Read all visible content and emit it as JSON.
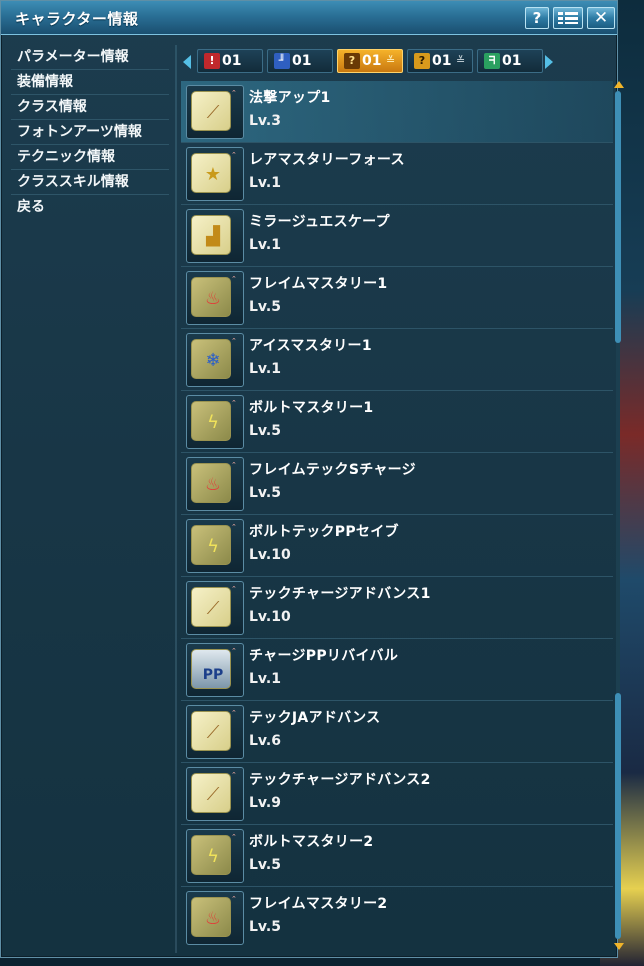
{
  "window": {
    "title": "キャラクター情報",
    "help_label": "?",
    "close_label": "✕"
  },
  "menu": {
    "items": [
      {
        "label": "パラメーター情報"
      },
      {
        "label": "装備情報"
      },
      {
        "label": "クラス情報"
      },
      {
        "label": "フォトンアーツ情報"
      },
      {
        "label": "テクニック情報"
      },
      {
        "label": "クラススキル情報"
      },
      {
        "label": "戻る"
      }
    ]
  },
  "tabs": [
    {
      "label": "01",
      "icon": "fire-icon",
      "color": "#c0282c",
      "active": false
    },
    {
      "label": "01",
      "icon": "ranger-icon",
      "color": "#2f5fc0",
      "active": false
    },
    {
      "label": "01",
      "icon": "force-icon",
      "color": "#e3a020",
      "active": true
    },
    {
      "label": "01",
      "icon": "force-icon",
      "color": "#e3a020",
      "active": false
    },
    {
      "label": "01",
      "icon": "techer-icon",
      "color": "#2aa060",
      "active": false
    }
  ],
  "skills": [
    {
      "name": "法撃アップ1",
      "level": "Lv.3",
      "icon": "staff-icon"
    },
    {
      "name": "レアマスタリーフォース",
      "level": "Lv.1",
      "icon": "staff-star-icon"
    },
    {
      "name": "ミラージュエスケープ",
      "level": "Lv.1",
      "icon": "boot-icon"
    },
    {
      "name": "フレイムマスタリー1",
      "level": "Lv.5",
      "icon": "flame-icon"
    },
    {
      "name": "アイスマスタリー1",
      "level": "Lv.1",
      "icon": "ice-icon"
    },
    {
      "name": "ボルトマスタリー1",
      "level": "Lv.5",
      "icon": "bolt-icon"
    },
    {
      "name": "フレイムテックSチャージ",
      "level": "Lv.5",
      "icon": "flame-icon"
    },
    {
      "name": "ボルトテックPPセイブ",
      "level": "Lv.10",
      "icon": "bolt-icon"
    },
    {
      "name": "テックチャージアドバンス1",
      "level": "Lv.10",
      "icon": "staff-icon"
    },
    {
      "name": "チャージPPリバイバル",
      "level": "Lv.1",
      "icon": "pp-icon"
    },
    {
      "name": "テックJAアドバンス",
      "level": "Lv.6",
      "icon": "staff-icon"
    },
    {
      "name": "テックチャージアドバンス2",
      "level": "Lv.9",
      "icon": "staff-icon"
    },
    {
      "name": "ボルトマスタリー2",
      "level": "Lv.5",
      "icon": "bolt-icon"
    },
    {
      "name": "フレイムマスタリー2",
      "level": "Lv.5",
      "icon": "flame-icon"
    }
  ],
  "icon_text": {
    "pp": "PP"
  }
}
